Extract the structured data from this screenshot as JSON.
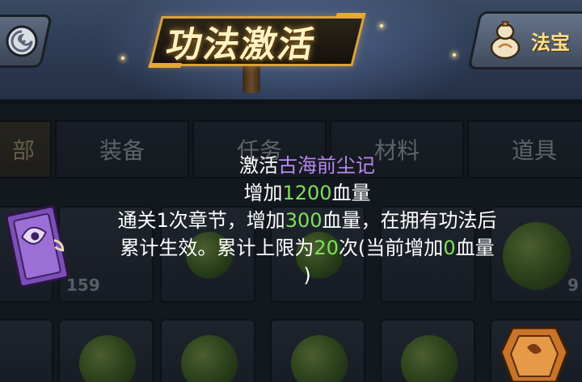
{
  "header": {
    "title": "功法激活",
    "treasure_button_label": "法宝"
  },
  "tabs": [
    {
      "label": "部"
    },
    {
      "label": "装备"
    },
    {
      "label": "任务"
    },
    {
      "label": "材料"
    },
    {
      "label": "道具"
    }
  ],
  "slots": {
    "count_left": "159",
    "count_right": "9"
  },
  "tooltip": {
    "line1_prefix": "激活",
    "line1_name": "古海前尘记",
    "line2_prefix": "增加",
    "line2_value": "1200",
    "line2_suffix": "血量",
    "line3_prefix": "通关1次章节，增加",
    "line3_value": "300",
    "line3_suffix": "血量，在拥有功法后",
    "line4_prefix": "累计生效。累计上限为",
    "line4_value": "20",
    "line4_mid": "次(当前增加",
    "line4_value2": "0",
    "line4_suffix": "血量",
    "line5": ")"
  },
  "colors": {
    "highlight_name": "#b98af0",
    "highlight_value": "#7ee05a",
    "title_gold": "#fff3c2"
  },
  "icons": {
    "back": "swirl-back-icon",
    "treasure": "gourd-icon",
    "item": "scroll-icon",
    "seal": "seal-icon"
  }
}
